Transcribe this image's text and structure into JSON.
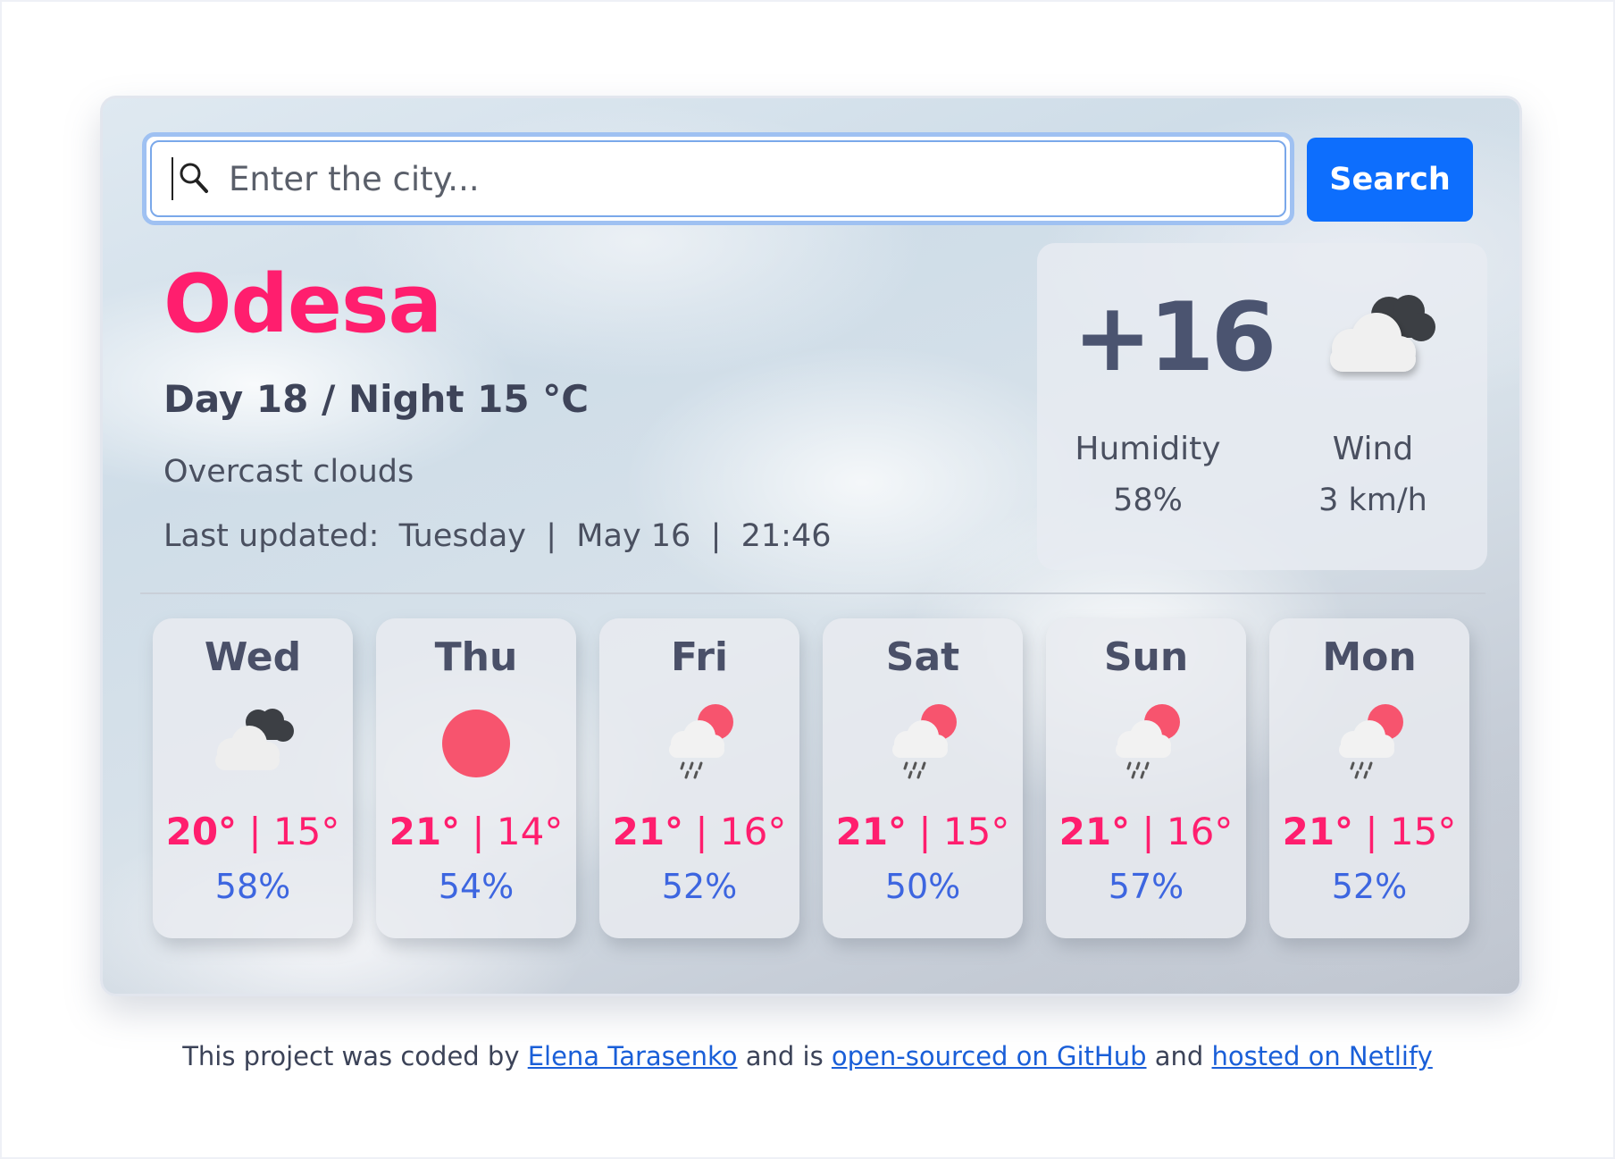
{
  "search": {
    "placeholder": "Enter the city...",
    "button_label": "Search"
  },
  "current": {
    "city": "Odesa",
    "day_night": "Day 18 / Night 15  °C",
    "description": "Overcast clouds",
    "last_updated": "Last updated:  Tuesday  |  May 16  |  21:46",
    "temperature": "+16",
    "icon": "broken-clouds-icon",
    "humidity_label": "Humidity",
    "humidity_value": "58%",
    "wind_label": "Wind",
    "wind_value": "3 km/h"
  },
  "forecast": [
    {
      "day": "Wed",
      "max": "20°",
      "sep": " | ",
      "min": "15°",
      "humidity": "58%",
      "icon": "broken-clouds-icon"
    },
    {
      "day": "Thu",
      "max": "21°",
      "sep": " | ",
      "min": "14°",
      "humidity": "54%",
      "icon": "sun-icon"
    },
    {
      "day": "Fri",
      "max": "21°",
      "sep": " | ",
      "min": "16°",
      "humidity": "52%",
      "icon": "sun-rain-cloud-icon"
    },
    {
      "day": "Sat",
      "max": "21°",
      "sep": " | ",
      "min": "15°",
      "humidity": "50%",
      "icon": "sun-rain-cloud-icon"
    },
    {
      "day": "Sun",
      "max": "21°",
      "sep": " | ",
      "min": "16°",
      "humidity": "57%",
      "icon": "sun-rain-cloud-icon"
    },
    {
      "day": "Mon",
      "max": "21°",
      "sep": " | ",
      "min": "15°",
      "humidity": "52%",
      "icon": "sun-rain-cloud-icon"
    }
  ],
  "footer": {
    "prefix": "This project was coded by ",
    "author_link": "Elena Tarasenko",
    "middle": " and is ",
    "github_link": "open-sourced on GitHub",
    "and": " and ",
    "netlify_link": "hosted on Netlify"
  },
  "colors": {
    "accent_pink": "#ff1e6e",
    "button_blue": "#0d6efd",
    "humidity_blue": "#3d66e0",
    "sun_red": "#f7546e"
  }
}
